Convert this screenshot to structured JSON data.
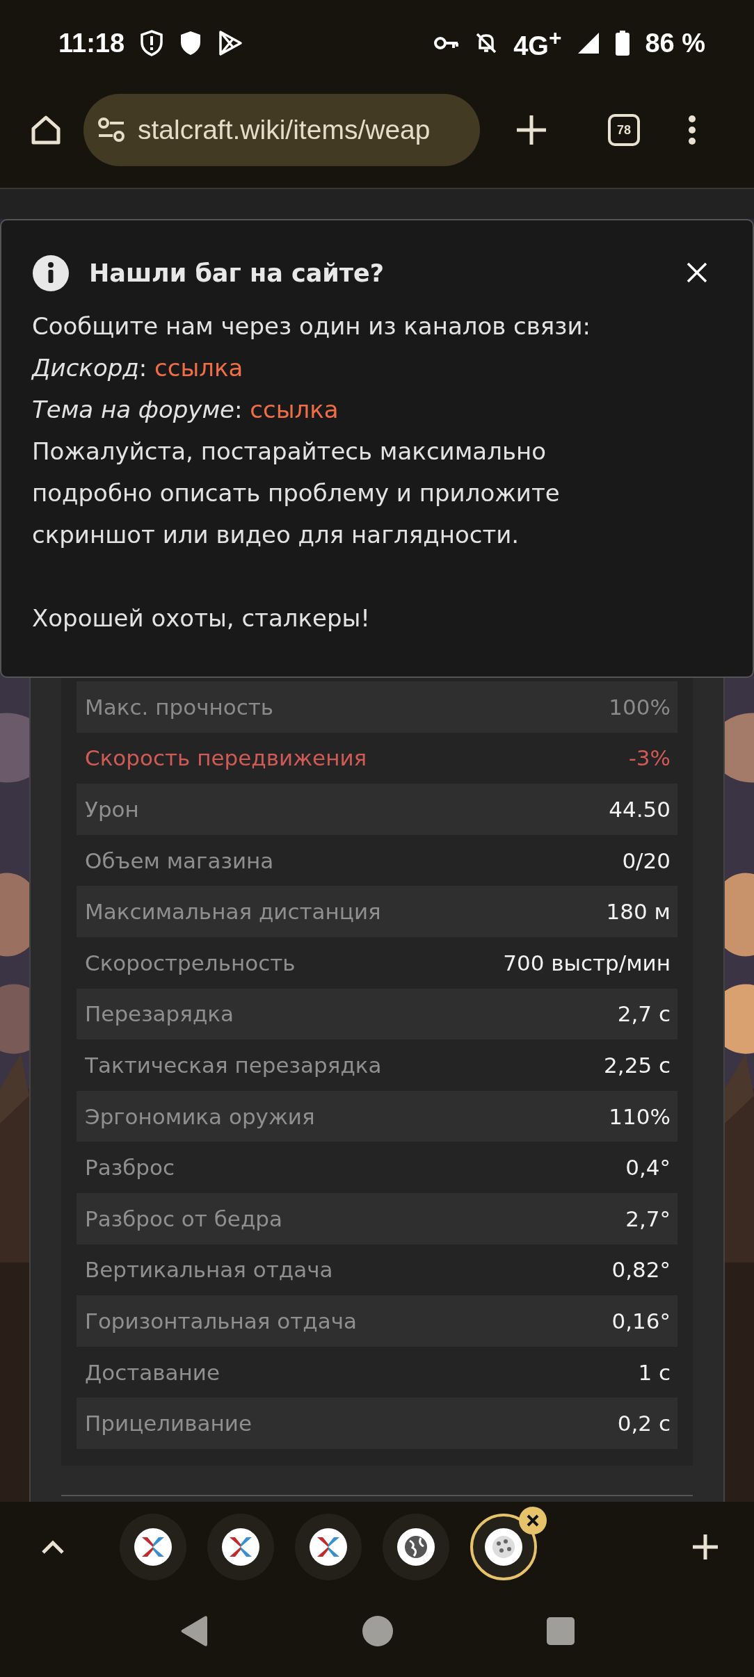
{
  "status_bar": {
    "time": "11:18",
    "network": "4G$^{+}$",
    "battery": "86 %"
  },
  "browser": {
    "url": "stalcraft.wiki/items/weap",
    "tab_count": "78"
  },
  "popup": {
    "title": "Нашли баг на сайте?",
    "intro": "Сообщите нам через один из каналов связи:",
    "contacts": [
      {
        "label": "*Дискорд*:",
        "link": "ссылка"
      },
      {
        "label": "*Тема на форуме*:",
        "link": "ссылка"
      }
    ],
    "paragraph": "Пожалуйста, постарайтесь максимально подробно описать проблему и приложите скриншот или видео для наглядности.",
    "farewell": "Хорошей охоты, сталкеры!"
  },
  "stats": [
    {
      "label": "Макс. прочность",
      "value": "100%",
      "dimmed": true,
      "negative": false
    },
    {
      "label": "Скорость передвижения",
      "value": "-3%",
      "dimmed": false,
      "negative": true
    },
    {
      "label": "Урон",
      "value": "44.50",
      "dimmed": false,
      "negative": false
    },
    {
      "label": "Объем магазина",
      "value": "0/20",
      "dimmed": false,
      "negative": false
    },
    {
      "label": "Максимальная дистанция",
      "value": "180 м",
      "dimmed": false,
      "negative": false
    },
    {
      "label": "Скорострельность",
      "value": "700 выстр/мин",
      "dimmed": false,
      "negative": false
    },
    {
      "label": "Перезарядка",
      "value": "2,7 с",
      "dimmed": false,
      "negative": false
    },
    {
      "label": "Тактическая перезарядка",
      "value": "2,25 с",
      "dimmed": false,
      "negative": false
    },
    {
      "label": "Эргономика оружия",
      "value": "110%",
      "dimmed": false,
      "negative": false
    },
    {
      "label": "Разброс",
      "value": "0,4°",
      "dimmed": false,
      "negative": false
    },
    {
      "label": "Разброс от бедра",
      "value": "2,7°",
      "dimmed": false,
      "negative": false
    },
    {
      "label": "Вертикальная отдача",
      "value": "0,82°",
      "dimmed": false,
      "negative": false
    },
    {
      "label": "Горизонтальная отдача",
      "value": "0,16°",
      "dimmed": false,
      "negative": false
    },
    {
      "label": "Доставание",
      "value": "1 с",
      "dimmed": false,
      "negative": false
    },
    {
      "label": "Прицеливание",
      "value": "0,2 с",
      "dimmed": false,
      "negative": false
    }
  ],
  "tab_strip": [
    {
      "kind": "cross",
      "selected": false
    },
    {
      "kind": "cross",
      "selected": false
    },
    {
      "kind": "cross",
      "selected": false
    },
    {
      "kind": "globe",
      "selected": false
    },
    {
      "kind": "dice",
      "selected": true
    }
  ]
}
